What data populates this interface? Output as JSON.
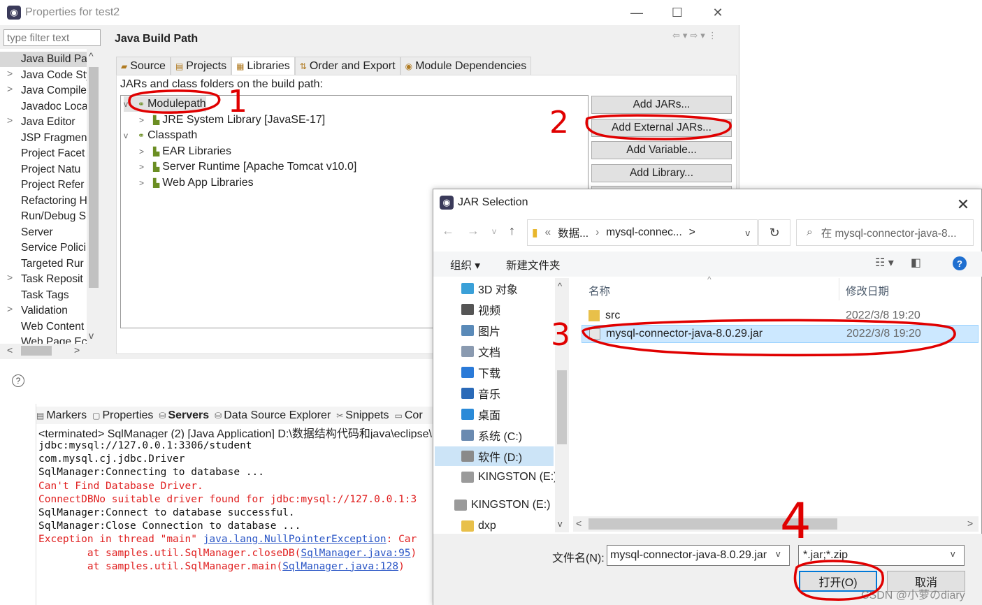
{
  "props": {
    "title": "Properties for test2",
    "filter_placeholder": "type filter text",
    "panel_title": "Java Build Path",
    "nav": [
      {
        "label": "Java Build Pa",
        "chev": "",
        "sel": true
      },
      {
        "label": "Java Code Sty",
        "chev": ">"
      },
      {
        "label": "Java Compile",
        "chev": ">"
      },
      {
        "label": "Javadoc Loca",
        "chev": ""
      },
      {
        "label": "Java Editor",
        "chev": ">"
      },
      {
        "label": "JSP Fragmen",
        "chev": ""
      },
      {
        "label": "Project Facet",
        "chev": ""
      },
      {
        "label": "Project Natu",
        "chev": ""
      },
      {
        "label": "Project Refer",
        "chev": ""
      },
      {
        "label": "Refactoring H",
        "chev": ""
      },
      {
        "label": "Run/Debug S",
        "chev": ""
      },
      {
        "label": "Server",
        "chev": ""
      },
      {
        "label": "Service Polici",
        "chev": ""
      },
      {
        "label": "Targeted Rur",
        "chev": ""
      },
      {
        "label": "Task Reposit",
        "chev": ">"
      },
      {
        "label": "Task Tags",
        "chev": ""
      },
      {
        "label": "Validation",
        "chev": ">"
      },
      {
        "label": "Web Content",
        "chev": ""
      },
      {
        "label": "Web Page Ec",
        "chev": ""
      }
    ],
    "tabs": [
      "Source",
      "Projects",
      "Libraries",
      "Order and Export",
      "Module Dependencies"
    ],
    "active_tab": "Libraries",
    "jar_desc": "JARs and class folders on the build path:",
    "tree": [
      {
        "label": "Modulepath",
        "chev": "v",
        "level": 0
      },
      {
        "label": "JRE System Library [JavaSE-17]",
        "chev": ">",
        "level": 1
      },
      {
        "label": "Classpath",
        "chev": "v",
        "level": 0
      },
      {
        "label": "EAR Libraries",
        "chev": ">",
        "level": 1
      },
      {
        "label": "Server Runtime [Apache Tomcat v10.0]",
        "chev": ">",
        "level": 1
      },
      {
        "label": "Web App Libraries",
        "chev": ">",
        "level": 1
      }
    ],
    "buttons": [
      "Add JARs...",
      "Add External JARs...",
      "Add Variable...",
      "Add Library..."
    ],
    "help": "?"
  },
  "console": {
    "tabs": [
      "Markers",
      "Properties",
      "Servers",
      "Data Source Explorer",
      "Snippets",
      "Cor"
    ],
    "status": "<terminated> SqlManager (2) [Java Application] D:\\数据结构代码和java\\eclipse\\",
    "lines": [
      {
        "text": "jdbc:mysql://127.0.0.1:3306/student",
        "err": false
      },
      {
        "text": "com.mysql.cj.jdbc.Driver",
        "err": false
      },
      {
        "text": "SqlManager:Connecting to database ...",
        "err": false
      },
      {
        "text": "Can't Find Database Driver.",
        "err": true
      },
      {
        "text": "ConnectDBNo suitable driver found for jdbc:mysql://127.0.0.1:3",
        "err": true
      },
      {
        "text": "SqlManager:Connect to database successful.",
        "err": false
      },
      {
        "text": "SqlManager:Close Connection to database ...",
        "err": false
      }
    ],
    "exception": {
      "pre": "Exception in thread \"main\" ",
      "link": "java.lang.NullPointerException",
      "post": ": Car"
    },
    "trace": [
      {
        "pre": "        at samples.util.SqlManager.closeDB(",
        "link": "SqlManager.java:95",
        "post": ")"
      },
      {
        "pre": "        at samples.util.SqlManager.main(",
        "link": "SqlManager.java:128",
        "post": ")"
      }
    ]
  },
  "dialog": {
    "title": "JAR Selection",
    "address": [
      "数据...",
      "mysql-connec...",
      ">"
    ],
    "address_prefix": "«",
    "search_placeholder": "在 mysql-connector-java-8...",
    "organize": "组织 ▾",
    "new_folder": "新建文件夹",
    "sidebar": [
      {
        "label": "3D 对象",
        "color": "#3aa0d8"
      },
      {
        "label": "视频",
        "color": "#555555"
      },
      {
        "label": "图片",
        "color": "#5a8ab8"
      },
      {
        "label": "文档",
        "color": "#8a9ab0"
      },
      {
        "label": "下载",
        "color": "#2a7ad8"
      },
      {
        "label": "音乐",
        "color": "#2a6ab8"
      },
      {
        "label": "桌面",
        "color": "#2a8ad8"
      },
      {
        "label": "系统 (C:)",
        "color": "#6a8ab0"
      },
      {
        "label": "软件 (D:)",
        "color": "#8a8a8a",
        "sel": true
      },
      {
        "label": "KINGSTON (E:)",
        "color": "#9a9a9a"
      },
      {
        "label": "KINGSTON (E:)",
        "color": "#9a9a9a"
      },
      {
        "label": "dxp",
        "color": "#e8c04a"
      }
    ],
    "col_name": "名称",
    "col_date": "修改日期",
    "files": [
      {
        "name": "src",
        "date": "2022/3/8 19:20",
        "type": "folder"
      },
      {
        "name": "mysql-connector-java-8.0.29.jar",
        "date": "2022/3/8 19:20",
        "type": "jar",
        "sel": true
      }
    ],
    "filename_label": "文件名(N):",
    "filename": "mysql-connector-java-8.0.29.jar",
    "filetype": "*.jar;*.zip",
    "open": "打开(O)",
    "cancel": "取消"
  },
  "annotations": [
    "1",
    "2",
    "3",
    "4"
  ],
  "watermark": "CSDN @小萝のdiary",
  "colors": {
    "annotation": "#e00000",
    "link": "#2a56c6",
    "error": "#e02020",
    "selection": "#cce8ff"
  }
}
